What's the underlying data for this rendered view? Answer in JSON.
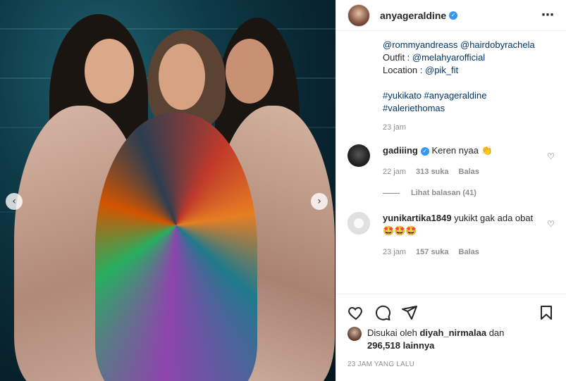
{
  "post": {
    "username": "anyageraldine",
    "caption": {
      "credits_line": "@rommyandreass @hairdobyrachela",
      "outfit_label": "Outfit : ",
      "outfit_value": "@melahyarofficial",
      "location_label": "Location : ",
      "location_value": "@pik_fit",
      "tags_line1": "#yukikato #anyageraldine",
      "tags_line2": "#valeriethomas",
      "time": "23 jam"
    },
    "comments": [
      {
        "username": "gadiiing",
        "text": "Keren nyaa 👏",
        "time": "22 jam",
        "likes": "313 suka",
        "reply": "Balas",
        "view_replies": "Lihat balasan (41)"
      },
      {
        "username": "yunikartika1849",
        "text": "yukikt gak ada obat🤩🤩🤩",
        "time": "23 jam",
        "likes": "157 suka",
        "reply": "Balas"
      }
    ],
    "liked_by_prefix": "Disukai oleh ",
    "liked_by_user": "diyah_nirmalaa",
    "liked_by_and": " dan",
    "liked_by_count": "296,518 lainnya",
    "posted_ago": "23 JAM YANG LALU"
  },
  "icons": {
    "verified": "verified-badge-icon",
    "more": "more-options-icon",
    "like": "heart-icon",
    "comment": "comment-icon",
    "share": "share-icon",
    "save": "bookmark-icon",
    "prev": "chevron-left-icon",
    "next": "chevron-right-icon"
  },
  "colors": {
    "link": "#00376b",
    "verified": "#3897f0",
    "muted": "#8e8e8e"
  }
}
